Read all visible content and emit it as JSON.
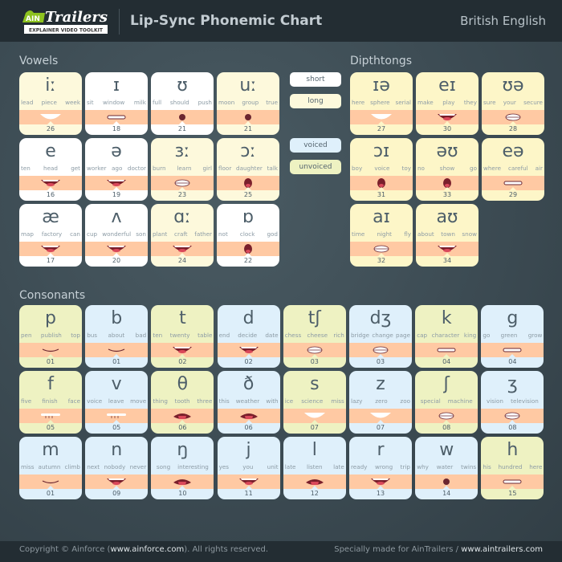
{
  "header": {
    "logo_text": "AinTrailers",
    "logo_tagline": "EXPLAINER VIDEO TOOLKIT",
    "title": "Lip-Sync Phonemic Chart",
    "language": "British English"
  },
  "colors": {
    "short": "#ffffff",
    "long": "#fdf9dc",
    "voiced": "#dff0fb",
    "unvoiced": "#eef2c2",
    "diphthong": "#fdf6c8",
    "band": "#ffc9a3"
  },
  "legend": [
    {
      "label": "short",
      "type": "short"
    },
    {
      "label": "long",
      "type": "long"
    },
    {
      "label": "voiced",
      "type": "voiced"
    },
    {
      "label": "unvoiced",
      "type": "unvoiced"
    }
  ],
  "sections": {
    "vowels": "Vowels",
    "diphthongs": "Dipthtongs",
    "consonants": "Consonants"
  },
  "vowels": [
    {
      "symbol": "iː",
      "words": [
        "lead",
        "piece",
        "week"
      ],
      "number": "26",
      "type": "long",
      "mouth": "wide"
    },
    {
      "symbol": "ɪ",
      "words": [
        "sit",
        "window",
        "milk"
      ],
      "number": "18",
      "type": "short",
      "mouth": "line"
    },
    {
      "symbol": "ʊ",
      "words": [
        "full",
        "should",
        "push"
      ],
      "number": "21",
      "type": "short",
      "mouth": "round"
    },
    {
      "symbol": "uː",
      "words": [
        "moon",
        "group",
        "true"
      ],
      "number": "21",
      "type": "long",
      "mouth": "round"
    },
    {
      "symbol": "e",
      "words": [
        "ten",
        "head",
        "get"
      ],
      "number": "16",
      "type": "short",
      "mouth": "open"
    },
    {
      "symbol": "ə",
      "words": [
        "worker",
        "ago",
        "doctor"
      ],
      "number": "19",
      "type": "short",
      "mouth": "open"
    },
    {
      "symbol": "ɜː",
      "words": [
        "burn",
        "learn",
        "girl"
      ],
      "number": "23",
      "type": "long",
      "mouth": "teeth"
    },
    {
      "symbol": "ɔː",
      "words": [
        "floor",
        "daughter",
        "talk"
      ],
      "number": "25",
      "type": "long",
      "mouth": "oval"
    },
    {
      "symbol": "æ",
      "words": [
        "map",
        "factory",
        "can"
      ],
      "number": "17",
      "type": "short",
      "mouth": "open"
    },
    {
      "symbol": "ʌ",
      "words": [
        "cup",
        "wonderful",
        "son"
      ],
      "number": "20",
      "type": "short",
      "mouth": "open"
    },
    {
      "symbol": "ɑː",
      "words": [
        "plant",
        "craft",
        "father"
      ],
      "number": "24",
      "type": "long",
      "mouth": "open"
    },
    {
      "symbol": "ɒ",
      "words": [
        "not",
        "clock",
        "god"
      ],
      "number": "22",
      "type": "short",
      "mouth": "oval"
    }
  ],
  "diphthongs": [
    {
      "symbol": "ɪə",
      "words": [
        "here",
        "sphere",
        "serial"
      ],
      "number": "27",
      "type": "diphthong",
      "mouth": "wide"
    },
    {
      "symbol": "eɪ",
      "words": [
        "make",
        "play",
        "they"
      ],
      "number": "30",
      "type": "diphthong",
      "mouth": "open"
    },
    {
      "symbol": "ʊə",
      "words": [
        "sure",
        "your",
        "secure"
      ],
      "number": "28",
      "type": "diphthong",
      "mouth": "teeth"
    },
    {
      "symbol": "ɔɪ",
      "words": [
        "boy",
        "voice",
        "toy"
      ],
      "number": "31",
      "type": "diphthong",
      "mouth": "oval"
    },
    {
      "symbol": "əʊ",
      "words": [
        "no",
        "show",
        "go"
      ],
      "number": "33",
      "type": "diphthong",
      "mouth": "oval"
    },
    {
      "symbol": "eə",
      "words": [
        "where",
        "careful",
        "air"
      ],
      "number": "29",
      "type": "diphthong",
      "mouth": "line"
    },
    {
      "symbol": "aɪ",
      "words": [
        "time",
        "night",
        "fly"
      ],
      "number": "32",
      "type": "diphthong",
      "mouth": "teeth"
    },
    {
      "symbol": "aʊ",
      "words": [
        "about",
        "town",
        "snow"
      ],
      "number": "34",
      "type": "diphthong",
      "mouth": "open"
    }
  ],
  "consonants": [
    {
      "symbol": "p",
      "words": [
        "pen",
        "publish",
        "top"
      ],
      "number": "01",
      "type": "unvoiced",
      "mouth": "closed"
    },
    {
      "symbol": "b",
      "words": [
        "bus",
        "about",
        "bad"
      ],
      "number": "01",
      "type": "voiced",
      "mouth": "closed"
    },
    {
      "symbol": "t",
      "words": [
        "ten",
        "twenty",
        "table"
      ],
      "number": "02",
      "type": "unvoiced",
      "mouth": "open"
    },
    {
      "symbol": "d",
      "words": [
        "end",
        "decide",
        "date"
      ],
      "number": "02",
      "type": "voiced",
      "mouth": "open"
    },
    {
      "symbol": "tʃ",
      "words": [
        "chess",
        "cheese",
        "rich"
      ],
      "number": "03",
      "type": "unvoiced",
      "mouth": "teeth"
    },
    {
      "symbol": "dʒ",
      "words": [
        "bridge",
        "change",
        "page"
      ],
      "number": "03",
      "type": "voiced",
      "mouth": "teeth"
    },
    {
      "symbol": "k",
      "words": [
        "cap",
        "character",
        "king"
      ],
      "number": "04",
      "type": "unvoiced",
      "mouth": "line"
    },
    {
      "symbol": "g",
      "words": [
        "go",
        "green",
        "grow"
      ],
      "number": "04",
      "type": "voiced",
      "mouth": "line"
    },
    {
      "symbol": "f",
      "words": [
        "five",
        "finish",
        "face"
      ],
      "number": "05",
      "type": "unvoiced",
      "mouth": "bite"
    },
    {
      "symbol": "v",
      "words": [
        "voice",
        "leave",
        "move"
      ],
      "number": "05",
      "type": "voiced",
      "mouth": "bite"
    },
    {
      "symbol": "θ",
      "words": [
        "thing",
        "tooth",
        "three"
      ],
      "number": "06",
      "type": "unvoiced",
      "mouth": "tongue"
    },
    {
      "symbol": "ð",
      "words": [
        "this",
        "weather",
        "with"
      ],
      "number": "06",
      "type": "voiced",
      "mouth": "tongue"
    },
    {
      "symbol": "s",
      "words": [
        "ice",
        "science",
        "miss"
      ],
      "number": "07",
      "type": "unvoiced",
      "mouth": "wide"
    },
    {
      "symbol": "z",
      "words": [
        "lazy",
        "zero",
        "zoo"
      ],
      "number": "07",
      "type": "voiced",
      "mouth": "wide"
    },
    {
      "symbol": "ʃ",
      "words": [
        "special",
        "machine"
      ],
      "number": "08",
      "type": "unvoiced",
      "mouth": "teeth"
    },
    {
      "symbol": "ʒ",
      "words": [
        "vision",
        "television"
      ],
      "number": "08",
      "type": "voiced",
      "mouth": "teeth"
    },
    {
      "symbol": "m",
      "words": [
        "miss",
        "autumn",
        "climb"
      ],
      "number": "01",
      "type": "voiced",
      "mouth": "closed"
    },
    {
      "symbol": "n",
      "words": [
        "next",
        "nobody",
        "never"
      ],
      "number": "09",
      "type": "voiced",
      "mouth": "open"
    },
    {
      "symbol": "ŋ",
      "words": [
        "song",
        "interesting"
      ],
      "number": "10",
      "type": "voiced",
      "mouth": "tongue"
    },
    {
      "symbol": "j",
      "words": [
        "yes",
        "you",
        "unit"
      ],
      "number": "11",
      "type": "voiced",
      "mouth": "open"
    },
    {
      "symbol": "l",
      "words": [
        "late",
        "listen",
        "late"
      ],
      "number": "12",
      "type": "voiced",
      "mouth": "tongue"
    },
    {
      "symbol": "r",
      "words": [
        "ready",
        "wrong",
        "trip"
      ],
      "number": "13",
      "type": "voiced",
      "mouth": "open"
    },
    {
      "symbol": "w",
      "words": [
        "why",
        "water",
        "twins"
      ],
      "number": "14",
      "type": "voiced",
      "mouth": "round"
    },
    {
      "symbol": "h",
      "words": [
        "his",
        "hundred",
        "here"
      ],
      "number": "15",
      "type": "unvoiced",
      "mouth": "line"
    }
  ],
  "footer": {
    "copyright_prefix": "Copyright © Ainforce (",
    "copyright_link": "www.ainforce.com",
    "copyright_suffix": "). All rights reserved.",
    "made_for": "Specially made for AinTrailers / ",
    "made_for_link": "www.aintrailers.com"
  }
}
